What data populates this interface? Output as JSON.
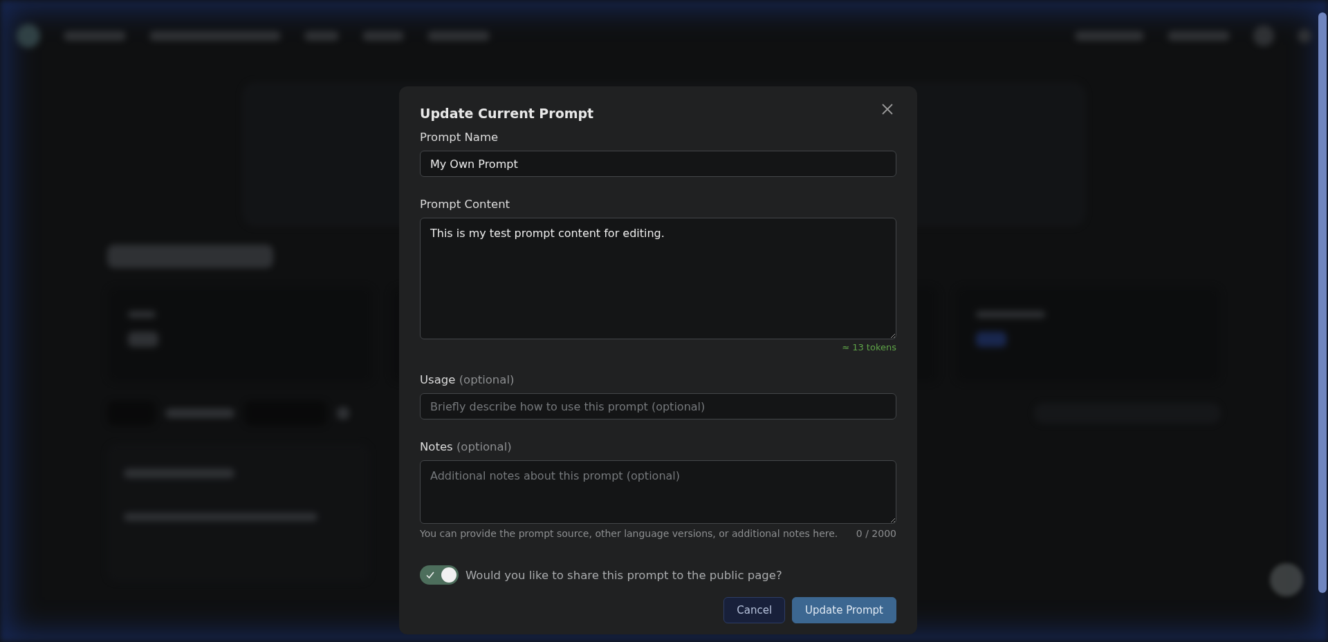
{
  "dialog": {
    "title": "Update Current Prompt",
    "fields": [
      {
        "kind": "input",
        "label": "Prompt Name",
        "value": "My Own Prompt"
      },
      {
        "kind": "textarea",
        "label": "Prompt Content",
        "value": "This is my test prompt content for editing.",
        "token_count": "≈ 13 tokens"
      },
      {
        "kind": "input",
        "label": "Usage",
        "optional": "(optional)",
        "placeholder": "Briefly describe how to use this prompt (optional)"
      },
      {
        "kind": "textarea",
        "label": "Notes",
        "optional": "(optional)",
        "placeholder": "Additional notes about this prompt (optional)",
        "helper": "You can provide the prompt source, other language versions, or additional notes here.",
        "counter": "0 / 2000"
      }
    ],
    "share_toggle": {
      "on": true,
      "label": "Would you like to share this prompt to the public page?"
    },
    "buttons": [
      {
        "label": "Cancel",
        "kind": "secondary"
      },
      {
        "label": "Update Prompt",
        "kind": "primary"
      }
    ]
  }
}
